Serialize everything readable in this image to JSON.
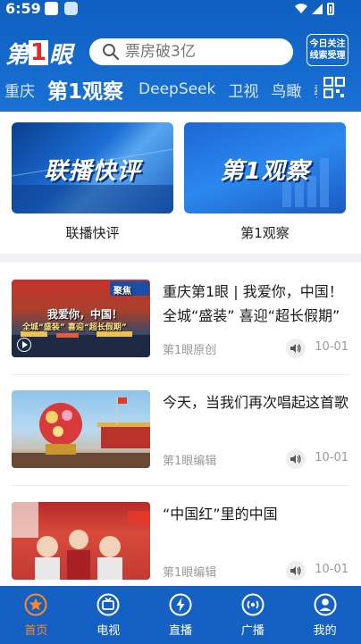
{
  "status": {
    "time": "6:59"
  },
  "header": {
    "logo": {
      "prefix": "第",
      "num": "1",
      "suffix": "眼"
    },
    "search": {
      "placeholder": "票房破3亿"
    },
    "follow_button": {
      "line1": "今日关注",
      "line2": "线索受理"
    },
    "channels": [
      "重庆",
      "第1观察",
      "DeepSeek",
      "卫视",
      "鸟瞰",
      "教育"
    ],
    "active_channel": "第1观察"
  },
  "features": [
    {
      "image_title": "联播快评",
      "caption": "联播快评"
    },
    {
      "image_title": "第1观察",
      "caption": "第1观察"
    }
  ],
  "news": [
    {
      "title": "重庆第1眼 | 我爱你，中国！ 全城“盛装” 喜迎“超长假期”",
      "source": "第1眼原创",
      "date": "10-01",
      "thumb_text1": "我爱你，中国！",
      "thumb_text2": "全城“盛装” 喜迎“超长假期”",
      "thumb_badge": "聚焦"
    },
    {
      "title": "今天，当我们再次唱起这首歌",
      "source": "第1眼编辑",
      "date": "10-01"
    },
    {
      "title": "“中国红”里的中国",
      "source": "第1眼编辑",
      "date": "10-01"
    }
  ],
  "tabs": [
    {
      "label": "首页",
      "icon": "star-icon",
      "active": true
    },
    {
      "label": "电视",
      "icon": "tv-icon",
      "active": false
    },
    {
      "label": "直播",
      "icon": "live-icon",
      "active": false
    },
    {
      "label": "广播",
      "icon": "radio-icon",
      "active": false
    },
    {
      "label": "我的",
      "icon": "profile-icon",
      "active": false
    }
  ],
  "colors": {
    "brand_blue": "#1560c3",
    "active_tab": "#ff8a1f"
  }
}
